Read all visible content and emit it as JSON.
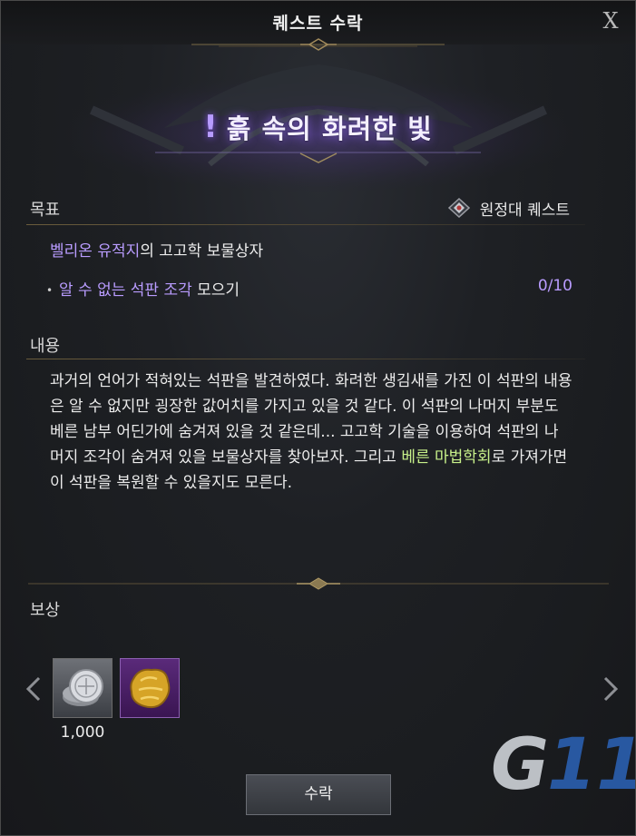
{
  "window": {
    "title": "퀘스트 수락",
    "close_label": "X"
  },
  "quest": {
    "name": "흙 속의 화려한 빛",
    "type_label": "원정대 퀘스트"
  },
  "objective": {
    "header": "목표",
    "title_parts": [
      "벨리온 유적지",
      "의 고고학 보물상자"
    ],
    "task": {
      "parts": [
        "알 수 없는 석판 조각",
        " 모으기"
      ],
      "progress": "0/10"
    }
  },
  "content": {
    "header": "내용",
    "parts": [
      "과거의 언어가 적혀있는 석판을 발견하였다. 화려한 생김새를 가진 이 석판의 내용은 알 수 없지만 굉장한 값어치를 가지고 있을 것 같다. 이 석판의 나머지 부분도 베른 남부 어딘가에 숨겨져 있을 것 같은데... 고고학 기술을 이용하여 석판의 나머지 조각이 숨겨져 있을 보물상자를 찾아보자. 그리고 ",
      "베른 마법학회",
      "로 가져가면 이 석판을 복원할 수 있을지도 모른다."
    ]
  },
  "rewards": {
    "header": "보상",
    "items": [
      {
        "icon": "silver-coins-icon",
        "quantity": "1,000"
      },
      {
        "icon": "gold-relic-icon",
        "quantity": ""
      }
    ]
  },
  "buttons": {
    "accept": "수락"
  },
  "watermark": {
    "text": "G11"
  },
  "colors": {
    "highlight_purple": "#b99cff",
    "highlight_green": "#c7f08a",
    "gold_line": "#6a5c3c"
  }
}
